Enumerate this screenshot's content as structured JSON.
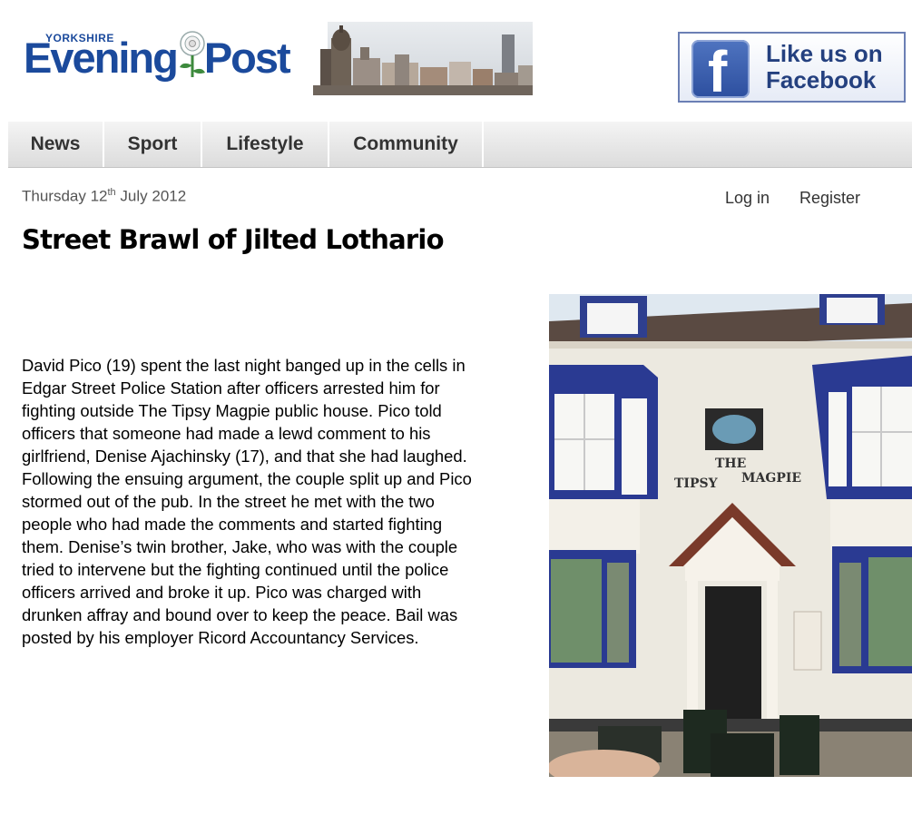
{
  "header": {
    "logo_small": "YORKSHIRE",
    "logo_left": "Evening",
    "logo_right": "Post",
    "facebook_line1": "Like us on",
    "facebook_line2": "Facebook",
    "facebook_icon": "facebook-f-icon",
    "brand_color": "#1b4a9c"
  },
  "nav": {
    "tabs": [
      {
        "label": "News"
      },
      {
        "label": "Sport"
      },
      {
        "label": "Lifestyle"
      },
      {
        "label": "Community"
      }
    ]
  },
  "date": {
    "weekday": "Thursday 12",
    "suffix": "th",
    "rest": " July 2012"
  },
  "auth": {
    "login": "Log in",
    "register": "Register"
  },
  "article": {
    "headline": "Street Brawl of Jilted Lothario",
    "body": "David Pico (19) spent the last night banged up in the cells in Edgar Street Police Station after officers arrested him for fighting outside The Tipsy Magpie public house.  Pico told officers that someone had made a lewd comment to his girlfriend, Denise Ajachinsky (17), and that she had laughed.  Following the ensuing argument, the couple split up and Pico stormed out of the pub.  In the street he met with the two people who had made the comments and started fighting them. Denise’s twin brother, Jake, who was with the couple tried to intervene but the fighting continued until the police officers arrived and broke it up.  Pico was charged with drunken affray and bound over to keep the peace.  Bail was posted by his employer Ricord Accountancy Services.",
    "photo_sign_line1": "THE",
    "photo_sign_line2": "TIPSY",
    "photo_sign_line3": "MAGPIE"
  }
}
